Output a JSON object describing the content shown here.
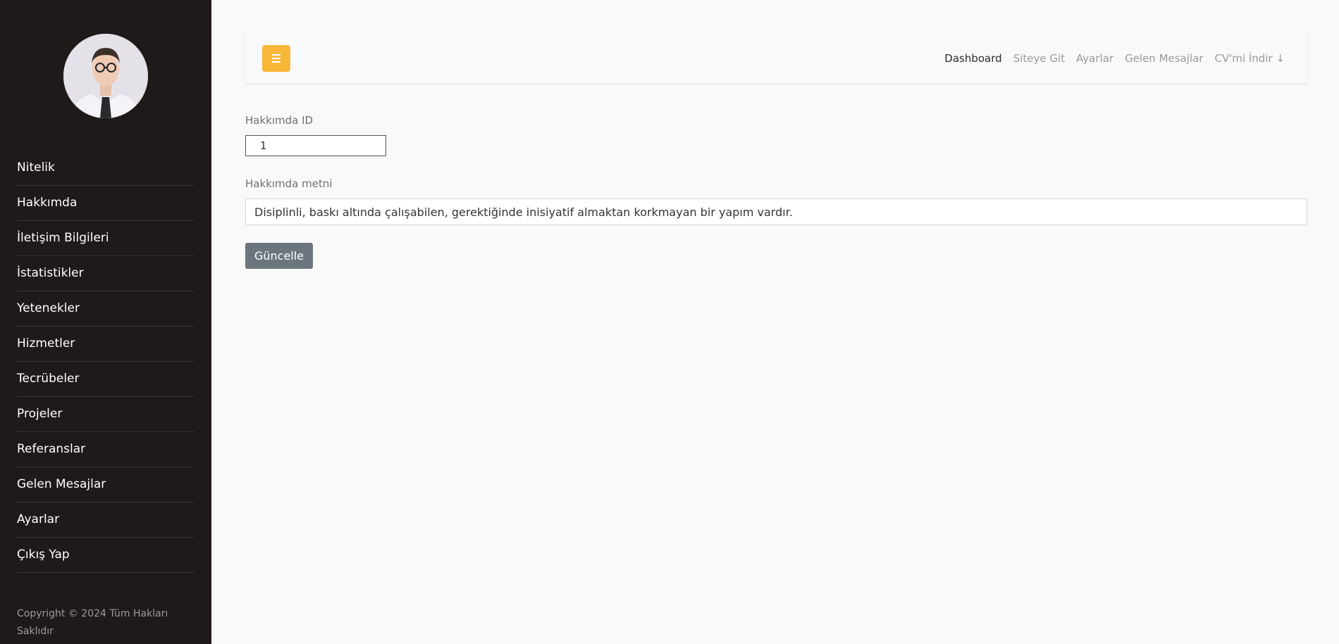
{
  "sidebar": {
    "avatar_icon": "user-portrait-icon",
    "items": [
      {
        "label": "Nitelik"
      },
      {
        "label": "Hakkımda"
      },
      {
        "label": "İletişim Bilgileri"
      },
      {
        "label": "İstatistikler"
      },
      {
        "label": "Yetenekler"
      },
      {
        "label": "Hizmetler"
      },
      {
        "label": "Tecrübeler"
      },
      {
        "label": "Projeler"
      },
      {
        "label": "Referanslar"
      },
      {
        "label": "Gelen Mesajlar"
      },
      {
        "label": "Ayarlar"
      },
      {
        "label": "Çıkış Yap"
      }
    ],
    "copyright": "Copyright © 2024 Tüm Hakları Saklıdır"
  },
  "topbar": {
    "menu_icon": "hamburger-icon",
    "accent_color": "#f8b739",
    "links": [
      {
        "label": "Dashboard",
        "active": true
      },
      {
        "label": "Siteye Git",
        "active": false
      },
      {
        "label": "Ayarlar",
        "active": false
      },
      {
        "label": "Gelen Mesajlar",
        "active": false
      },
      {
        "label": "CV'mi İndir ↓",
        "active": false
      }
    ]
  },
  "form": {
    "id_label": "Hakkımda ID",
    "id_value": "1",
    "text_label": "Hakkımda metni",
    "text_value": "Disiplinli, baskı altında çalışabilen, gerektiğinde inisiyatif almaktan korkmayan bir yapım vardır.",
    "submit_label": "Güncelle"
  }
}
